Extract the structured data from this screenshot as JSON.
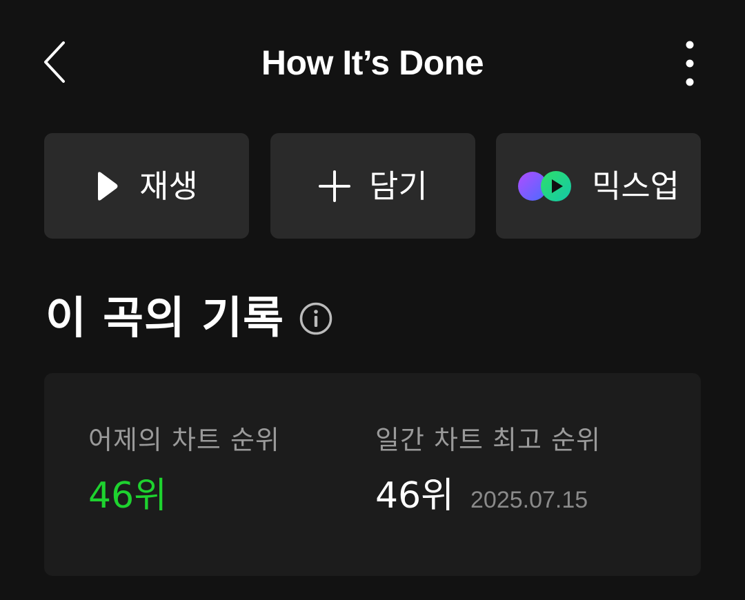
{
  "header": {
    "title": "How It’s Done",
    "back_icon": "chevron-left-icon",
    "more_icon": "more-vertical-icon"
  },
  "actions": {
    "play_label": "재생",
    "add_label": "담기",
    "mix_label": "믹스업"
  },
  "section": {
    "title": "이 곡의 기록",
    "info_icon": "info-icon"
  },
  "stats": {
    "yesterday": {
      "label": "어제의 차트 순위",
      "value": "46위"
    },
    "best": {
      "label": "일간 차트 최고 순위",
      "value": "46위",
      "date": "2025.07.15"
    }
  },
  "colors": {
    "background": "#121212",
    "button_bg": "#2a2a2a",
    "card_bg": "#1c1c1c",
    "accent_green": "#1ed22f"
  }
}
